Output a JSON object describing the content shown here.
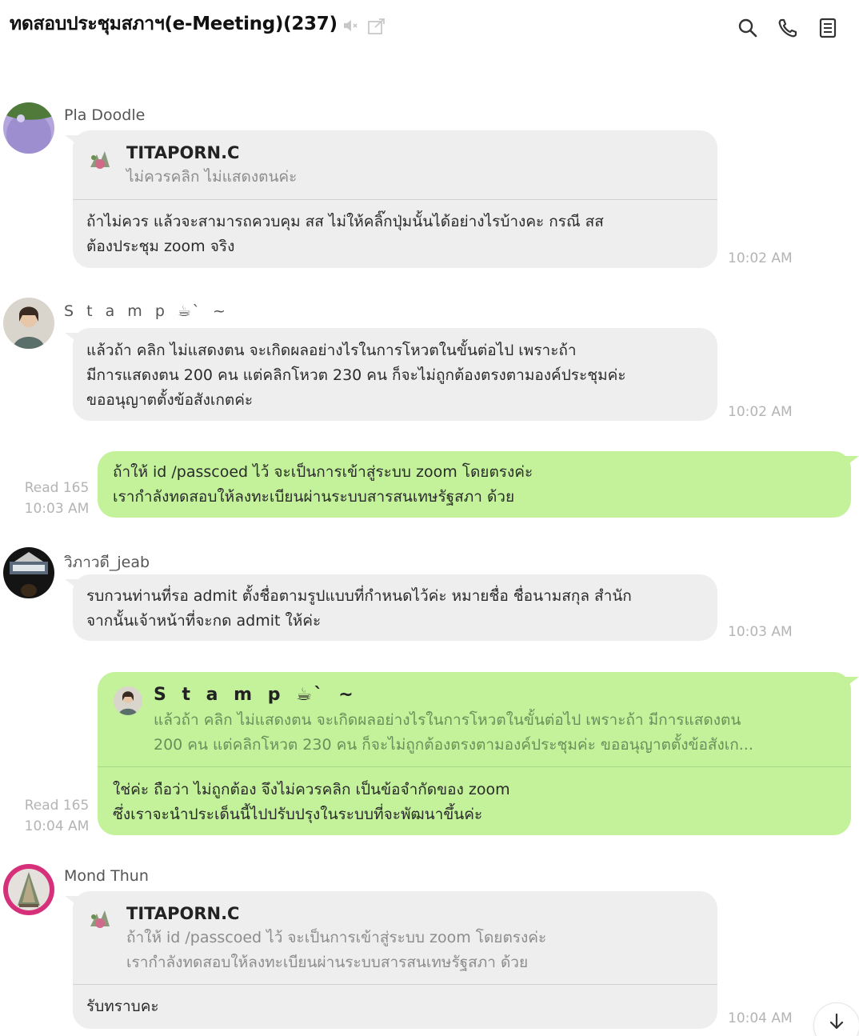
{
  "header": {
    "title": "ทดสอบประชุมสภาฯ(e-Meeting)(237)",
    "icons": [
      "speaker-muted-icon",
      "external-window-icon",
      "search-icon",
      "phone-icon",
      "notes-icon"
    ]
  },
  "messages": [
    {
      "sender": "Pla Doodle",
      "quote": {
        "name": "TITAPORN.C",
        "text": "ไม่ควรคลิก ไม่แสดงตนค่ะ"
      },
      "text": "ถ้าไม่ควร แล้วจะสามารถควบคุม สส ไม่ให้คลิ๊กปุ่มนั้นได้อย่างไรบ้างคะ กรณี สส\nต้องประชุม zoom จริง",
      "time": "10:02 AM"
    },
    {
      "sender": "S t a m p ☕ ̀ ~",
      "text": "แล้วถ้า คลิก ไม่แสดงตน จะเกิดผลอย่างไรในการโหวตในขั้นต่อไป เพราะถ้า\nมีการแสดงตน 200 คน แต่คลิกโหวต 230 คน ก็จะไม่ถูกต้องตรงตามองค์ประชุมค่ะ\nขออนุญาตตั้งข้อสังเกตค่ะ",
      "time": "10:02 AM"
    },
    {
      "read": "Read 165",
      "time": "10:03 AM",
      "text": "ถ้าให้ id /passcoed ไว้ จะเป็นการเข้าสู่ระบบ zoom โดยตรงค่ะ\nเรากำลังทดสอบให้ลงทะเบียนผ่านระบบสารสนเทษรัฐสภา ด้วย"
    },
    {
      "sender": "วิภาวดี_jeab",
      "text": "รบกวนท่านที่รอ admit ตั้งชื่อตามรูปแบบที่กำหนดไว้ค่ะ หมายชื่อ ชื่อนามสกุล สำนัก\nจากนั้นเจ้าหน้าที่จะกด admit ให้ค่ะ",
      "time": "10:03 AM"
    },
    {
      "read": "Read 165",
      "time": "10:04 AM",
      "quote": {
        "name": "S t a m p ☕ ̀ ~",
        "text": "แล้วถ้า คลิก ไม่แสดงตน จะเกิดผลอย่างไรในการโหวตในขั้นต่อไป เพราะถ้า มีการแสดงตน\n200 คน แต่คลิกโหวต 230 คน ก็จะไม่ถูกต้องตรงตามองค์ประชุมค่ะ ขออนุญาตตั้งข้อสังเก..."
      },
      "text": "ใช่ค่ะ  ถือว่า ไม่ถูกต้อง จึงไม่ควรคลิก  เป็นข้อจำกัดของ zoom\nซึ่งเราจะนำประเด็นนี้ไปปรับปรุงในระบบที่จะพัฒนาขึ้นค่ะ"
    },
    {
      "sender": "Mond Thun",
      "quote": {
        "name": "TITAPORN.C",
        "text": "ถ้าให้ id /passcoed ไว้ จะเป็นการเข้าสู่ระบบ zoom โดยตรงค่ะ\nเรากำลังทดสอบให้ลงทะเบียนผ่านระบบสารสนเทษรัฐสภา ด้วย"
      },
      "text": "รับทราบคะ",
      "time": "10:04 AM"
    }
  ],
  "colors": {
    "incoming_bubble": "#eeeeee",
    "outgoing_bubble": "#c3f29b",
    "timestamp": "#b4b4b4"
  }
}
